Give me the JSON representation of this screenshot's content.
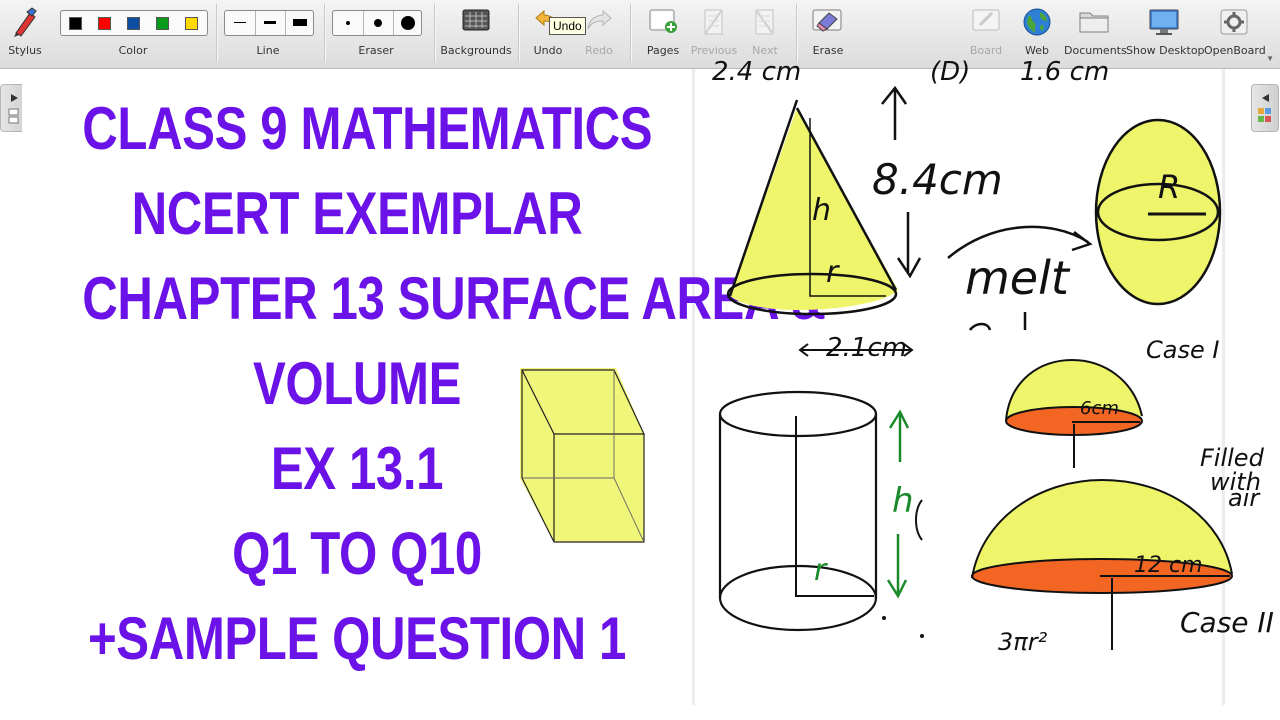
{
  "toolbar": {
    "items": [
      {
        "id": "stylus",
        "label": "Stylus",
        "enabled": true,
        "icon": "stylus-icon"
      },
      {
        "id": "color",
        "label": "Color",
        "enabled": true
      },
      {
        "id": "line",
        "label": "Line",
        "enabled": true
      },
      {
        "id": "eraser",
        "label": "Eraser",
        "enabled": true
      },
      {
        "id": "backgrounds",
        "label": "Backgrounds",
        "enabled": true,
        "icon": "keyboard-grid-icon"
      },
      {
        "id": "undo",
        "label": "Undo",
        "enabled": true,
        "icon": "undo-arrow-icon"
      },
      {
        "id": "redo",
        "label": "Redo",
        "enabled": false,
        "icon": "redo-arrow-icon"
      },
      {
        "id": "pages",
        "label": "Pages",
        "enabled": true,
        "icon": "add-page-icon"
      },
      {
        "id": "previous",
        "label": "Previous",
        "enabled": false,
        "icon": "previous-page-icon"
      },
      {
        "id": "next",
        "label": "Next",
        "enabled": false,
        "icon": "next-page-icon"
      },
      {
        "id": "erase",
        "label": "Erase",
        "enabled": true,
        "icon": "erase-board-icon"
      },
      {
        "id": "board",
        "label": "Board",
        "enabled": false,
        "icon": "board-icon"
      },
      {
        "id": "web",
        "label": "Web",
        "enabled": true,
        "icon": "globe-icon"
      },
      {
        "id": "documents",
        "label": "Documents",
        "enabled": true,
        "icon": "folder-icon"
      },
      {
        "id": "show_desktop",
        "label": "Show Desktop",
        "enabled": true,
        "icon": "monitor-icon"
      },
      {
        "id": "openboard",
        "label": "OpenBoard",
        "enabled": true,
        "icon": "gear-icon"
      }
    ],
    "colors": [
      "#000000",
      "#ff0000",
      "#0b4ea2",
      "#0a9a1a",
      "#ffd800"
    ],
    "tooltip": "Undo"
  },
  "slide": {
    "title_color": "#6a12e8",
    "lines": [
      "CLASS 9 MATHEMATICS",
      "NCERT EXEMPLAR",
      "CHAPTER 13 SURFACE AREA &",
      "VOLUME",
      "EX 13.1",
      "Q1 TO Q10",
      "+SAMPLE QUESTION 1"
    ]
  },
  "handwriting": {
    "top_cut": "2.4 cm",
    "top_cut_option": "(D)",
    "top_cut_value": "1.6 cm",
    "cone_height": "8.4cm",
    "cone_h": "h",
    "cone_r": "r",
    "cone_base": "2.1cm",
    "melt": "melt",
    "sphere_r": "R",
    "cyl_h": "h",
    "cyl_r": "r",
    "case1": "Case I",
    "hemi1": "6cm",
    "filled": [
      "Filled",
      "with",
      "air"
    ],
    "hemi2": "12 cm",
    "case2": "Case II",
    "bottom": "3πr²"
  },
  "colors": {
    "highlight_yellow": "#eef56a",
    "highlight_orange": "#f26522",
    "pen_green": "#1a8a2a"
  }
}
